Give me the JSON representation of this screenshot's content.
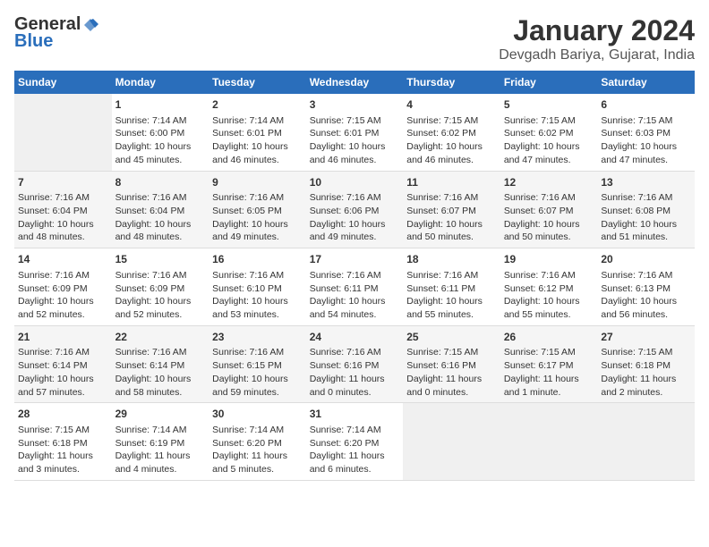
{
  "header": {
    "logo_general": "General",
    "logo_blue": "Blue",
    "title": "January 2024",
    "subtitle": "Devgadh Bariya, Gujarat, India"
  },
  "days_of_week": [
    "Sunday",
    "Monday",
    "Tuesday",
    "Wednesday",
    "Thursday",
    "Friday",
    "Saturday"
  ],
  "weeks": [
    [
      {
        "day": "",
        "content": ""
      },
      {
        "day": "1",
        "content": "Sunrise: 7:14 AM\nSunset: 6:00 PM\nDaylight: 10 hours\nand 45 minutes."
      },
      {
        "day": "2",
        "content": "Sunrise: 7:14 AM\nSunset: 6:01 PM\nDaylight: 10 hours\nand 46 minutes."
      },
      {
        "day": "3",
        "content": "Sunrise: 7:15 AM\nSunset: 6:01 PM\nDaylight: 10 hours\nand 46 minutes."
      },
      {
        "day": "4",
        "content": "Sunrise: 7:15 AM\nSunset: 6:02 PM\nDaylight: 10 hours\nand 46 minutes."
      },
      {
        "day": "5",
        "content": "Sunrise: 7:15 AM\nSunset: 6:02 PM\nDaylight: 10 hours\nand 47 minutes."
      },
      {
        "day": "6",
        "content": "Sunrise: 7:15 AM\nSunset: 6:03 PM\nDaylight: 10 hours\nand 47 minutes."
      }
    ],
    [
      {
        "day": "7",
        "content": "Sunrise: 7:16 AM\nSunset: 6:04 PM\nDaylight: 10 hours\nand 48 minutes."
      },
      {
        "day": "8",
        "content": "Sunrise: 7:16 AM\nSunset: 6:04 PM\nDaylight: 10 hours\nand 48 minutes."
      },
      {
        "day": "9",
        "content": "Sunrise: 7:16 AM\nSunset: 6:05 PM\nDaylight: 10 hours\nand 49 minutes."
      },
      {
        "day": "10",
        "content": "Sunrise: 7:16 AM\nSunset: 6:06 PM\nDaylight: 10 hours\nand 49 minutes."
      },
      {
        "day": "11",
        "content": "Sunrise: 7:16 AM\nSunset: 6:07 PM\nDaylight: 10 hours\nand 50 minutes."
      },
      {
        "day": "12",
        "content": "Sunrise: 7:16 AM\nSunset: 6:07 PM\nDaylight: 10 hours\nand 50 minutes."
      },
      {
        "day": "13",
        "content": "Sunrise: 7:16 AM\nSunset: 6:08 PM\nDaylight: 10 hours\nand 51 minutes."
      }
    ],
    [
      {
        "day": "14",
        "content": "Sunrise: 7:16 AM\nSunset: 6:09 PM\nDaylight: 10 hours\nand 52 minutes."
      },
      {
        "day": "15",
        "content": "Sunrise: 7:16 AM\nSunset: 6:09 PM\nDaylight: 10 hours\nand 52 minutes."
      },
      {
        "day": "16",
        "content": "Sunrise: 7:16 AM\nSunset: 6:10 PM\nDaylight: 10 hours\nand 53 minutes."
      },
      {
        "day": "17",
        "content": "Sunrise: 7:16 AM\nSunset: 6:11 PM\nDaylight: 10 hours\nand 54 minutes."
      },
      {
        "day": "18",
        "content": "Sunrise: 7:16 AM\nSunset: 6:11 PM\nDaylight: 10 hours\nand 55 minutes."
      },
      {
        "day": "19",
        "content": "Sunrise: 7:16 AM\nSunset: 6:12 PM\nDaylight: 10 hours\nand 55 minutes."
      },
      {
        "day": "20",
        "content": "Sunrise: 7:16 AM\nSunset: 6:13 PM\nDaylight: 10 hours\nand 56 minutes."
      }
    ],
    [
      {
        "day": "21",
        "content": "Sunrise: 7:16 AM\nSunset: 6:14 PM\nDaylight: 10 hours\nand 57 minutes."
      },
      {
        "day": "22",
        "content": "Sunrise: 7:16 AM\nSunset: 6:14 PM\nDaylight: 10 hours\nand 58 minutes."
      },
      {
        "day": "23",
        "content": "Sunrise: 7:16 AM\nSunset: 6:15 PM\nDaylight: 10 hours\nand 59 minutes."
      },
      {
        "day": "24",
        "content": "Sunrise: 7:16 AM\nSunset: 6:16 PM\nDaylight: 11 hours\nand 0 minutes."
      },
      {
        "day": "25",
        "content": "Sunrise: 7:15 AM\nSunset: 6:16 PM\nDaylight: 11 hours\nand 0 minutes."
      },
      {
        "day": "26",
        "content": "Sunrise: 7:15 AM\nSunset: 6:17 PM\nDaylight: 11 hours\nand 1 minute."
      },
      {
        "day": "27",
        "content": "Sunrise: 7:15 AM\nSunset: 6:18 PM\nDaylight: 11 hours\nand 2 minutes."
      }
    ],
    [
      {
        "day": "28",
        "content": "Sunrise: 7:15 AM\nSunset: 6:18 PM\nDaylight: 11 hours\nand 3 minutes."
      },
      {
        "day": "29",
        "content": "Sunrise: 7:14 AM\nSunset: 6:19 PM\nDaylight: 11 hours\nand 4 minutes."
      },
      {
        "day": "30",
        "content": "Sunrise: 7:14 AM\nSunset: 6:20 PM\nDaylight: 11 hours\nand 5 minutes."
      },
      {
        "day": "31",
        "content": "Sunrise: 7:14 AM\nSunset: 6:20 PM\nDaylight: 11 hours\nand 6 minutes."
      },
      {
        "day": "",
        "content": ""
      },
      {
        "day": "",
        "content": ""
      },
      {
        "day": "",
        "content": ""
      }
    ]
  ]
}
